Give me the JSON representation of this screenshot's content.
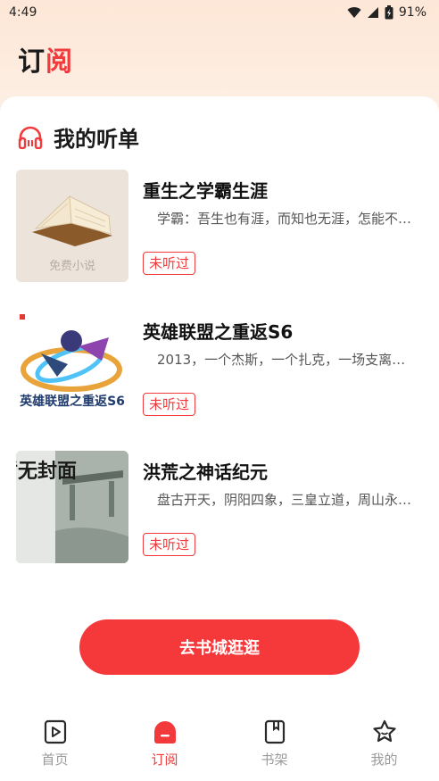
{
  "status_bar": {
    "time": "4:49",
    "battery": "91%"
  },
  "header": {
    "title_part1": "订",
    "title_part2": "阅"
  },
  "section": {
    "title": "我的听单"
  },
  "books": [
    {
      "title": "重生之学霸生涯",
      "desc": "学霸：吾生也有涯，而知也无涯，怎能不…",
      "status": "未听过",
      "cover_text": "免费小说"
    },
    {
      "title": "英雄联盟之重返S6",
      "desc": "2013，一个杰斯，一个扎克，一场支离…",
      "status": "未听过",
      "cover_text": "英雄联盟之重返S6"
    },
    {
      "title": "洪荒之神话纪元",
      "desc": "盘古开天，阴阳四象，三皇立道，周山永…",
      "status": "未听过",
      "cover_text": "暂无封面"
    }
  ],
  "cta": {
    "label": "去书城逛逛"
  },
  "tabs": [
    {
      "label": "首页",
      "icon": "play-book-icon",
      "active": false
    },
    {
      "label": "订阅",
      "icon": "subscribe-icon",
      "active": true
    },
    {
      "label": "书架",
      "icon": "bookshelf-icon",
      "active": false
    },
    {
      "label": "我的",
      "icon": "star-profile-icon",
      "active": false
    }
  ],
  "colors": {
    "accent": "#f23a3c",
    "button": "#f5383a",
    "inactive": "#9a9a9a"
  }
}
